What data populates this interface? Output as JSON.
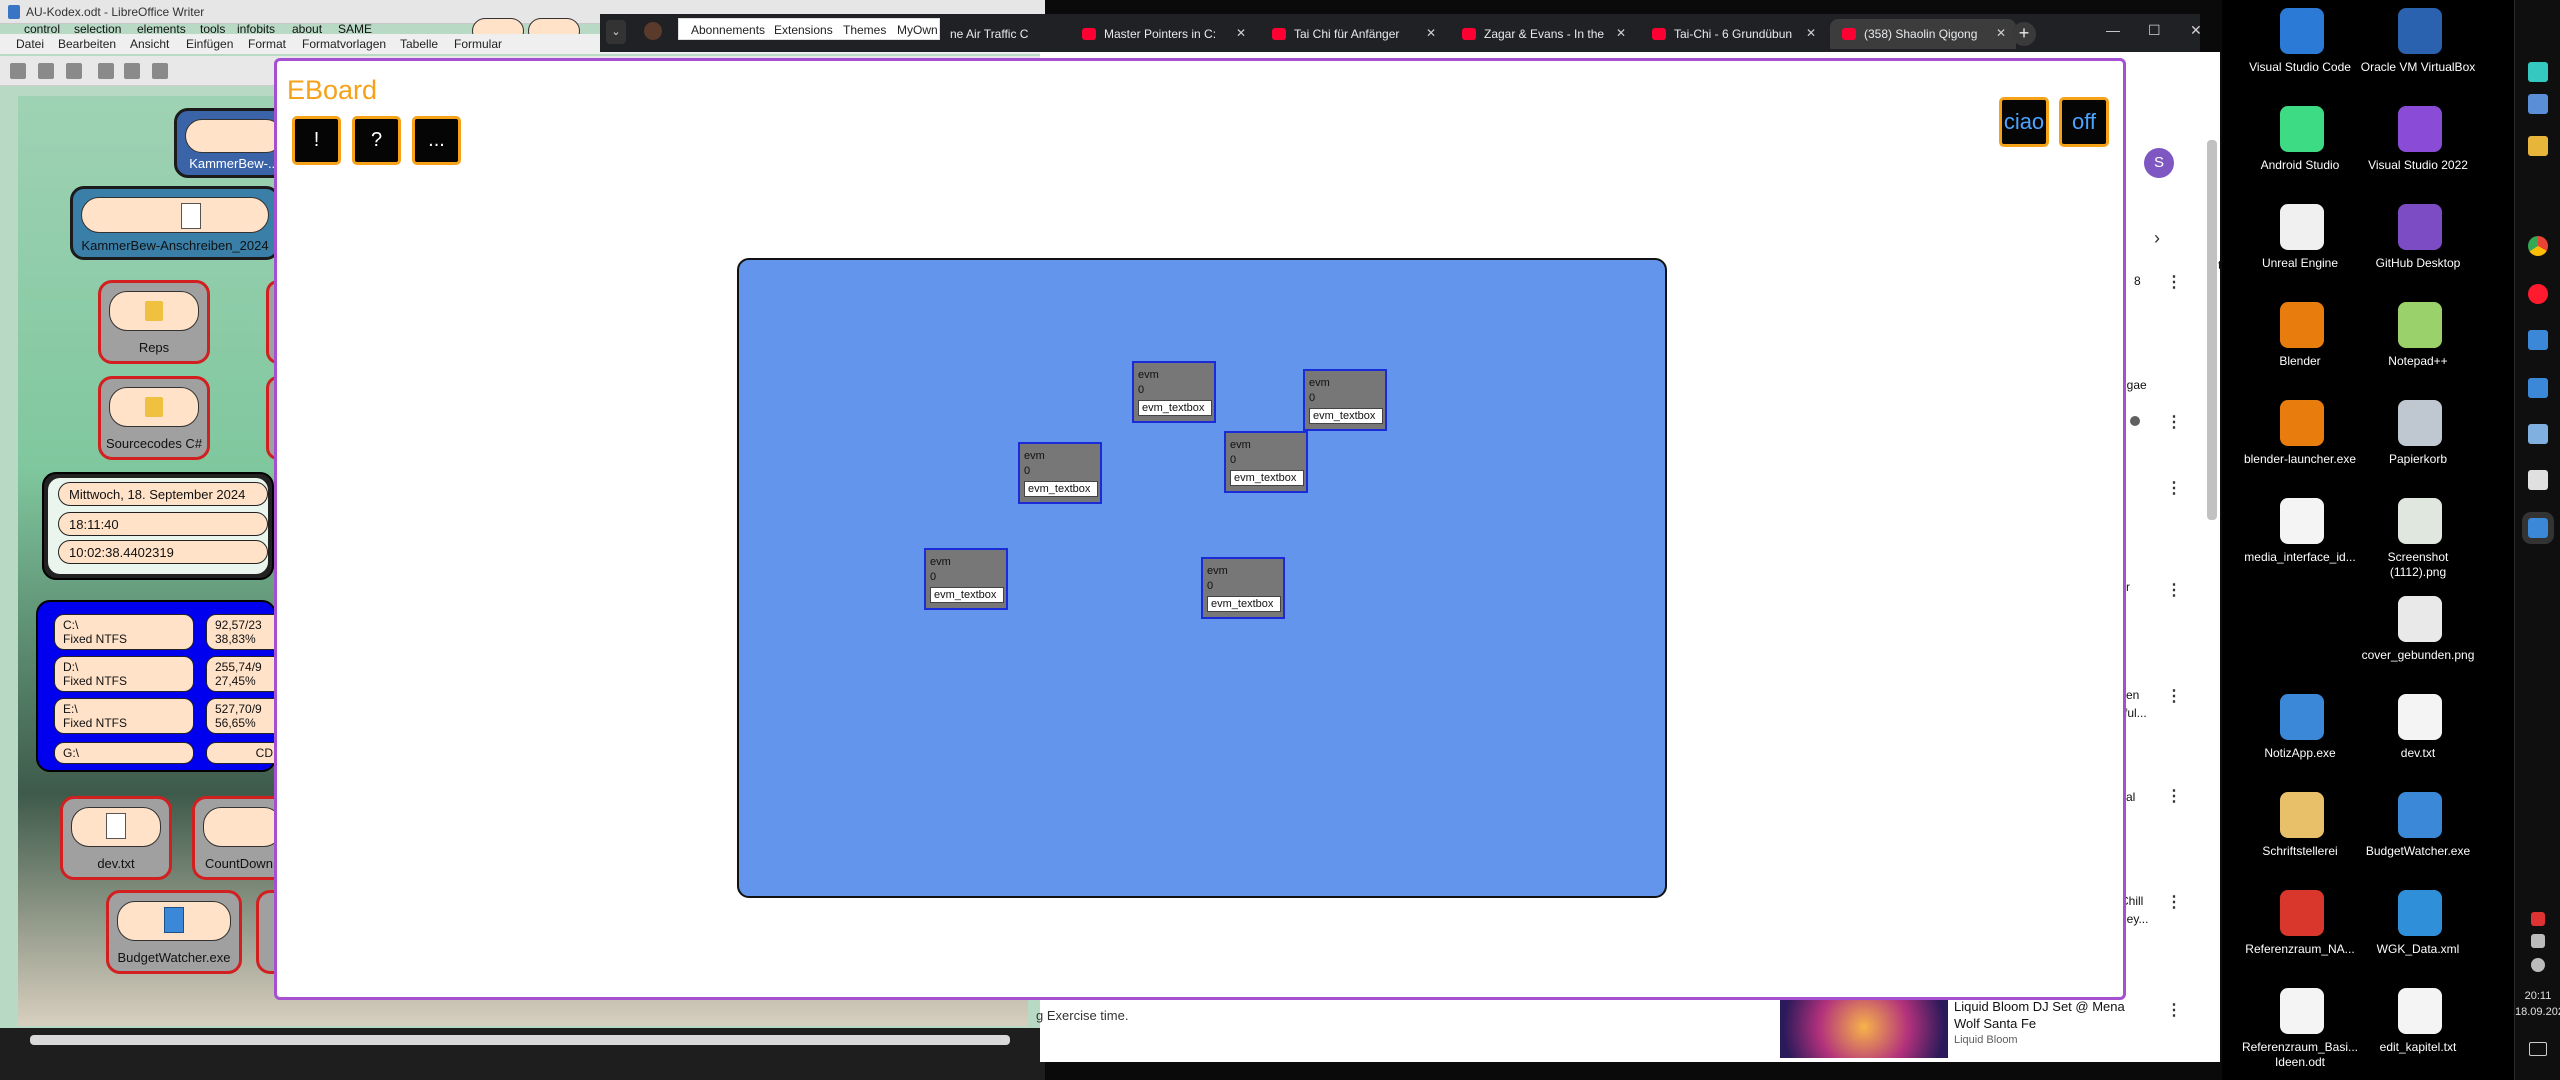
{
  "libreoffice": {
    "title": "AU-Kodex.odt - LibreOffice Writer",
    "menu": [
      "Datei",
      "Bearbeiten",
      "Ansicht",
      "Einfügen",
      "Format",
      "Formatvorlagen",
      "Tabelle",
      "Formular"
    ],
    "overlay_menu": [
      "control",
      "selection",
      "elements",
      "tools",
      "infobits",
      "about",
      "SAME"
    ],
    "tiles": [
      {
        "label": "Reps",
        "kind": "folder"
      },
      {
        "label": "Sourcecodes C#",
        "kind": "folder"
      },
      {
        "label": "dev.txt",
        "kind": "doc"
      },
      {
        "label": "CountDown",
        "kind": "app"
      },
      {
        "label": "BudgetWatcher.exe",
        "kind": "app"
      }
    ],
    "top_tiles": [
      "KammerBew-...",
      "KammerBew-Anschreiben_2024"
    ],
    "clock": {
      "date": "Mittwoch, 18. September 2024",
      "time": "18:11:40",
      "uptime": "10:02:38.4402319"
    },
    "drives": [
      {
        "name": "C:\\",
        "type": "Fixed NTFS",
        "size": "92,57/23",
        "pct": "38,83%"
      },
      {
        "name": "D:\\",
        "type": "Fixed NTFS",
        "size": "255,74/9",
        "pct": "27,45%"
      },
      {
        "name": "E:\\",
        "type": "Fixed NTFS",
        "size": "527,70/9",
        "pct": "56,65%"
      },
      {
        "name": "G:\\",
        "type": "",
        "size": "CD",
        "pct": ""
      }
    ]
  },
  "browser": {
    "ext_menu": [
      "Abonnements",
      "Extensions",
      "Themes",
      "MyOwn"
    ],
    "partial_tab": "ne Air Traffic C",
    "tabs": [
      {
        "title": "Master Pointers in C:",
        "active": false
      },
      {
        "title": "Tai Chi für Anfänger",
        "active": false
      },
      {
        "title": "Zagar & Evans - In the",
        "active": false
      },
      {
        "title": "Tai-Chi - 6 Grundübun",
        "active": false
      },
      {
        "title": "(358) Shaolin Qigong",
        "active": true
      }
    ],
    "bottom_text": "g Exercise time.",
    "avatar_letter": "S",
    "sidebar_fragments": [
      "te)",
      "8",
      "ggae",
      "r",
      "zen",
      "rful...",
      "val",
      "Chill",
      "rley..."
    ],
    "now_playing": {
      "title_1": "Liquid Bloom DJ Set @ Mena",
      "title_2": "Wolf Santa Fe",
      "channel": "Liquid Bloom"
    }
  },
  "eboard": {
    "title": "EBoard",
    "buttons_left": [
      "!",
      "?",
      "..."
    ],
    "buttons_right": [
      "ciao",
      "off"
    ],
    "widgets": [
      {
        "label": "evm",
        "value": "0",
        "box": "evm_textbox"
      },
      {
        "label": "evm",
        "value": "0",
        "box": "evm_textbox"
      },
      {
        "label": "evm",
        "value": "0",
        "box": "evm_textbox"
      },
      {
        "label": "evm",
        "value": "0",
        "box": "evm_textbox"
      },
      {
        "label": "evm",
        "value": "0",
        "box": "evm_textbox"
      },
      {
        "label": "evm",
        "value": "0",
        "box": "evm_textbox"
      }
    ]
  },
  "desktop": {
    "icons": [
      {
        "label": "Visual Studio Code",
        "color": "#2b7bd6"
      },
      {
        "label": "Oracle VM VirtualBox",
        "color": "#2a62b0"
      },
      {
        "label": "Android Studio",
        "color": "#3ddc84"
      },
      {
        "label": "Visual Studio 2022",
        "color": "#8a4bd6"
      },
      {
        "label": "Unreal Engine",
        "color": "#f0f0f0"
      },
      {
        "label": "GitHub Desktop",
        "color": "#7b4cc4"
      },
      {
        "label": "Blender",
        "color": "#e87d0d"
      },
      {
        "label": "Notepad++",
        "color": "#9bd16b"
      },
      {
        "label": "blender-launcher.exe",
        "color": "#e87d0d"
      },
      {
        "label": "Papierkorb",
        "color": "#bfc8d0"
      },
      {
        "label": "media_interface_id...",
        "color": "#f4f4f4"
      },
      {
        "label": "Screenshot (1112).png",
        "color": "#dfe7df"
      },
      {
        "label": "",
        "color": "#000000"
      },
      {
        "label": "cover_gebunden.png",
        "color": "#e9e9e9"
      },
      {
        "label": "NotizApp.exe",
        "color": "#3b88d8"
      },
      {
        "label": "dev.txt",
        "color": "#f4f4f4"
      },
      {
        "label": "Schriftstellerei",
        "color": "#e8c06a"
      },
      {
        "label": "BudgetWatcher.exe",
        "color": "#3b88d8"
      },
      {
        "label": "Referenzraum_NA...",
        "color": "#d9372c"
      },
      {
        "label": "WGK_Data.xml",
        "color": "#2f8fd8"
      },
      {
        "label": "Referenzraum_Basi... Ideen.odt",
        "color": "#f4f4f4"
      },
      {
        "label": "edit_kapitel.txt",
        "color": "#f4f4f4"
      }
    ]
  },
  "taskbar": {
    "time": "20:11",
    "date": "18.09.2024"
  }
}
